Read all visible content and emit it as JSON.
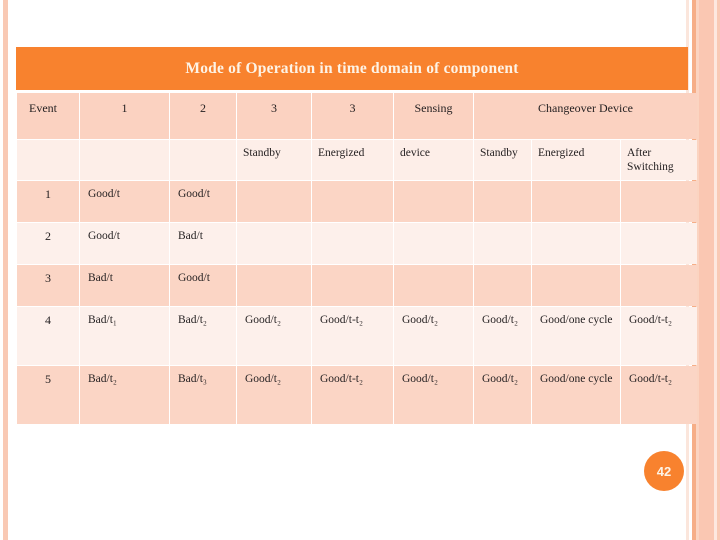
{
  "slide": {
    "page_number": "42",
    "accent_color": "#f8822e",
    "table_row_odd_color": "#fbd5c5",
    "table_row_even_color": "#fdf0eb"
  },
  "table": {
    "title": "Mode of Operation in time domain of component",
    "header_row_1": [
      "Event",
      "1",
      "2",
      "3",
      "3",
      "Sensing",
      "Changeover Device"
    ],
    "header_row_2": [
      "",
      "",
      "",
      "Standby",
      "Energized",
      "device",
      "Standby",
      "Energized",
      "After Switching"
    ],
    "rows": [
      {
        "event": "1",
        "c1": "Good/t",
        "c2": "Good/t",
        "c3_standby": "",
        "c3_energized": "",
        "sensing_device": "",
        "co_standby": "",
        "co_energized": "",
        "co_after_switching": ""
      },
      {
        "event": "2",
        "c1": "Good/t",
        "c2": "Bad/t",
        "c3_standby": "",
        "c3_energized": "",
        "sensing_device": "",
        "co_standby": "",
        "co_energized": "",
        "co_after_switching": ""
      },
      {
        "event": "3",
        "c1": "Bad/t",
        "c2": "Good/t",
        "c3_standby": "",
        "c3_energized": "",
        "sensing_device": "",
        "co_standby": "",
        "co_energized": "",
        "co_after_switching": ""
      },
      {
        "event": "4",
        "c1": "Bad/t₁",
        "c2": "Bad/t₂",
        "c3_standby": "Good/t₂",
        "c3_energized": "Good/t-t₂",
        "sensing_device": "Good/t₂",
        "co_standby": "Good/t₂",
        "co_energized": "Good/one cycle",
        "co_after_switching": "Good/t-t₂"
      },
      {
        "event": "5",
        "c1": "Bad/t₂",
        "c2": "Bad/t₃",
        "c3_standby": "Good/t₂",
        "c3_energized": "Good/t-t₂",
        "sensing_device": "Good/t₂",
        "co_standby": "Good/t₂",
        "co_energized": "Good/one cycle",
        "co_after_switching": "Good/t-t₂"
      }
    ]
  }
}
